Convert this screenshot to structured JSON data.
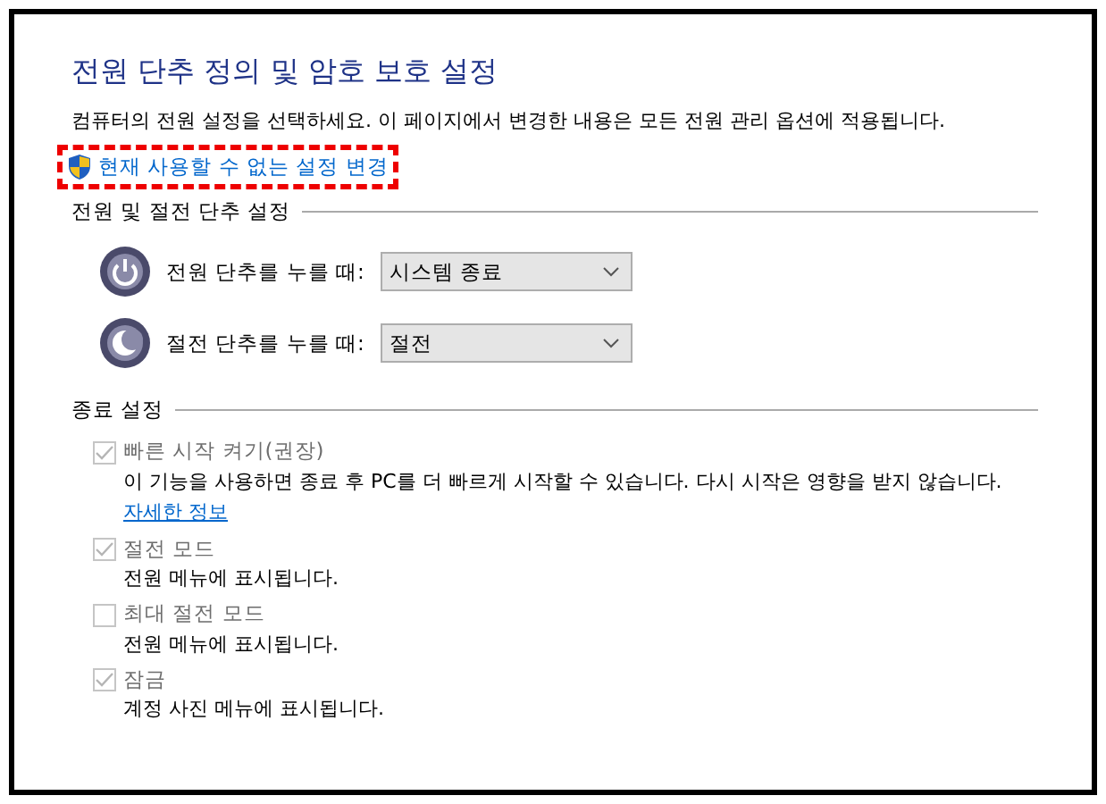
{
  "title": "전원 단추 정의 및 암호 보호 설정",
  "description": "컴퓨터의 전원 설정을 선택하세요. 이 페이지에서 변경한 내용은 모든 전원 관리 옵션에 적용됩니다.",
  "admin_link": {
    "label": "현재 사용할 수 없는 설정 변경",
    "highlighted": true
  },
  "button_section": {
    "heading": "전원 및 절전 단추 설정",
    "rows": [
      {
        "kind": "power",
        "label": "전원 단추를 누를 때:",
        "value": "시스템 종료"
      },
      {
        "kind": "sleep",
        "label": "절전 단추를 누를 때:",
        "value": "절전"
      }
    ]
  },
  "shutdown_section": {
    "heading": "종료 설정",
    "options": [
      {
        "label": "빠른 시작 켜기(권장)",
        "checked": true,
        "disabled": true,
        "description": "이 기능을 사용하면 종료 후 PC를 더 빠르게 시작할 수 있습니다. 다시 시작은 영향을 받지 않습니다.",
        "link": "자세한 정보"
      },
      {
        "label": "절전 모드",
        "checked": true,
        "disabled": true,
        "description": "전원 메뉴에 표시됩니다."
      },
      {
        "label": "최대 절전 모드",
        "checked": false,
        "disabled": true,
        "description": "전원 메뉴에 표시됩니다."
      },
      {
        "label": "잠금",
        "checked": true,
        "disabled": true,
        "description": "계정 사진 메뉴에 표시됩니다."
      }
    ]
  }
}
